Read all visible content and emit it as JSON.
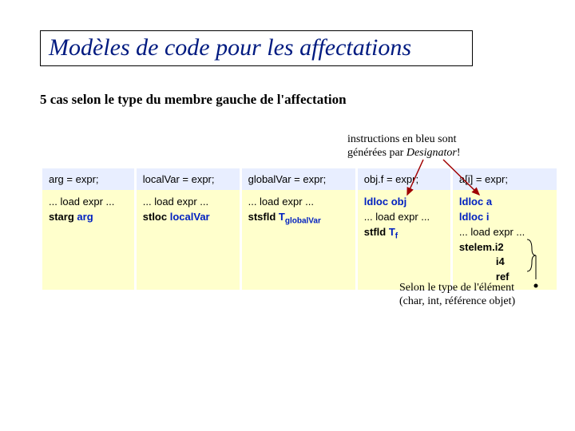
{
  "title": "Modèles de code pour les affectations",
  "subtitle": "5 cas selon le type du membre gauche de l'affectation",
  "note_blue_line1": "instructions en bleu sont",
  "note_blue_line2_a": "générées par ",
  "note_blue_line2_b": "Designator",
  "note_blue_line2_c": "!",
  "footnote_line1": "Selon le type de l'élément",
  "footnote_line2": "(char, int, référence objet)",
  "cols": {
    "c0": "arg = expr;",
    "c1": "localVar = expr;",
    "c2": "globalVar = expr;",
    "c3": "obj.f = expr;",
    "c4": "a[i] = expr;"
  },
  "body": {
    "c0": {
      "l1": "... load expr ...",
      "l2a": "starg ",
      "l2b": "arg"
    },
    "c1": {
      "l1": "... load expr ...",
      "l2a": "stloc ",
      "l2b": "localVar"
    },
    "c2": {
      "l1": "... load expr ...",
      "l2a": "stsfld ",
      "l2b": "T",
      "l2c": "globalVar"
    },
    "c3": {
      "l1a": "ldloc ",
      "l1b": "obj",
      "l2": "... load expr ...",
      "l3a": "stfld ",
      "l3b": "T",
      "l3c": "f"
    },
    "c4": {
      "l1a": "ldloc ",
      "l1b": "a",
      "l2a": "ldloc ",
      "l2b": "i",
      "l3": "... load expr ...",
      "l4a": "stelem.",
      "l4b": "i2",
      "l5": "i4",
      "l6": "ref"
    }
  }
}
